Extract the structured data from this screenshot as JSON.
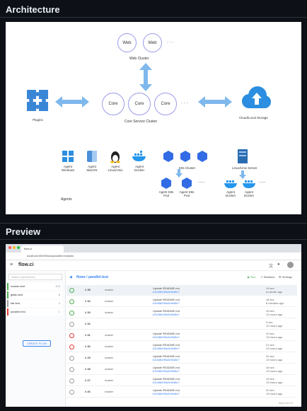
{
  "sections": {
    "architecture": "Architecture",
    "preview": "Preview"
  },
  "arch": {
    "web_nodes": [
      "Web",
      "Web"
    ],
    "web_cluster": "Web Cluster",
    "core_nodes": [
      "Core",
      "Core",
      "Core"
    ],
    "core_cluster": "Core Service Cluster",
    "plugins": "Plugins",
    "storage": "Cloud/Local Storage",
    "agents_title": "Agents",
    "agent_os": [
      "Agent Windows",
      "Agent MacOS",
      "Agent Linux/Unix",
      "Agent Docker"
    ],
    "k8s_cluster": "K8s Cluster",
    "linux_server": "Linux/Unix Server",
    "k8s_pods": [
      "Agent K8s Pod",
      "Agent K8s Pod"
    ],
    "docker_agents": [
      "Agent Docker",
      "Agent Docker"
    ],
    "ellipsis": "....."
  },
  "preview": {
    "tab_title": "flow.ci",
    "url": "localhost:3000/flows/parallel-test/jobs",
    "logo": "flow.ci",
    "search_placeholder": "Search parameters",
    "flows": [
      {
        "name": "master-test",
        "count": "123",
        "color": "#4caf50"
      },
      {
        "name": "gitlab-test",
        "count": "8",
        "color": "#4caf50"
      },
      {
        "name": "fail-test",
        "count": "4",
        "color": "#9e9e9e"
      },
      {
        "name": "parallel-test",
        "count": "1",
        "color": "#e53935"
      }
    ],
    "create_label": "CREATE FLOW",
    "breadcrumb": "flows / parallel-test",
    "actions": [
      "Run",
      "Statistics",
      "Settings"
    ],
    "jobs": [
      {
        "num": "# 35",
        "branch": "master",
        "commit": "Update README.md",
        "sha": "b2b38b0f9a3ef0d8e7",
        "time": "19 sec",
        "ago": "a minute ago",
        "status": "#4caf50"
      },
      {
        "num": "# 34",
        "branch": "master",
        "commit": "Update README.md",
        "sha": "b2b38b0f9a3ef0d8e7",
        "time": "18 sec",
        "ago": "8 minutes ago",
        "status": "#4caf50"
      },
      {
        "num": "# 33",
        "branch": "master",
        "commit": "Update README.md",
        "sha": "b2b38b0f9a3ef0d8e7",
        "time": "19 sec",
        "ago": "12 hours ago",
        "status": "#4caf50"
      },
      {
        "num": "# 32",
        "branch": "",
        "commit": "",
        "sha": "",
        "time": "0 sec",
        "ago": "12 hours ago",
        "status": "#9e9e9e"
      },
      {
        "num": "# 31",
        "branch": "master",
        "commit": "Update README.md",
        "sha": "b2b38b0f9a3ef0d8e7",
        "time": "20 sec",
        "ago": "13 hours ago",
        "status": "#e53935"
      },
      {
        "num": "# 30",
        "branch": "master",
        "commit": "Update README.md",
        "sha": "b2b38b0f9a3ef0d8e7",
        "time": "21 sec",
        "ago": "13 hours ago",
        "status": "#e53935"
      },
      {
        "num": "# 29",
        "branch": "master",
        "commit": "Update README.md",
        "sha": "b2b38b0f9a3ef0d8e7",
        "time": "20 sec",
        "ago": "13 hours ago",
        "status": "#9e9e9e"
      },
      {
        "num": "# 28",
        "branch": "master",
        "commit": "Update README.md",
        "sha": "b2b38b0f9a3ef0d8e7",
        "time": "18 sec",
        "ago": "13 hours ago",
        "status": "#9e9e9e"
      },
      {
        "num": "# 27",
        "branch": "master",
        "commit": "Update README.md",
        "sha": "b2b38b0f9a3ef0d8e7",
        "time": "19 sec",
        "ago": "13 hours ago",
        "status": "#9e9e9e"
      },
      {
        "num": "# 26",
        "branch": "master",
        "commit": "Update README.md",
        "sha": "b2b38b0f9a3ef0d8e7",
        "time": "20 sec",
        "ago": "13 hours ago",
        "status": "#9e9e9e"
      }
    ],
    "footer": "flow.ci v0.2.0"
  }
}
